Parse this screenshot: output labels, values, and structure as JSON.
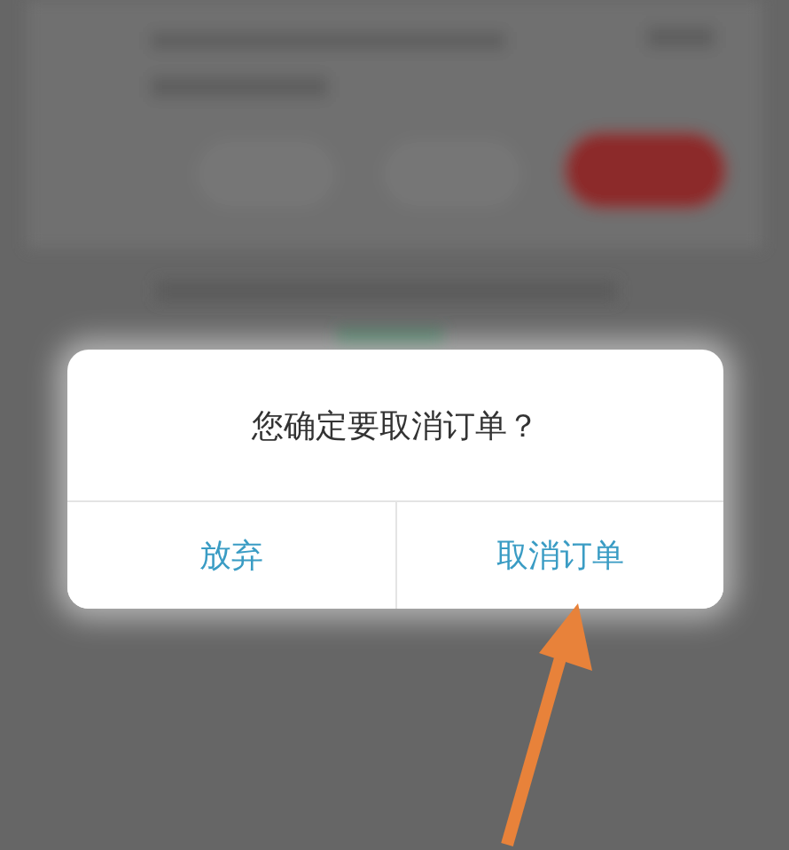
{
  "dialog": {
    "message": "您确定要取消订单？",
    "buttons": [
      {
        "label": "放弃"
      },
      {
        "label": "取消订单"
      }
    ]
  }
}
